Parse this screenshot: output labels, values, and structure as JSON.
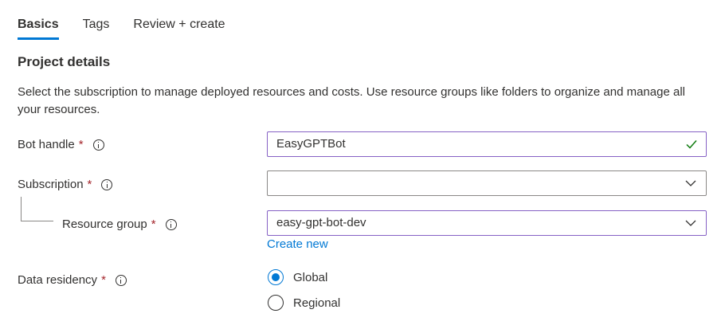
{
  "tabs": [
    {
      "label": "Basics",
      "active": true
    },
    {
      "label": "Tags",
      "active": false
    },
    {
      "label": "Review + create",
      "active": false
    }
  ],
  "section": {
    "title": "Project details",
    "description": "Select the subscription to manage deployed resources and costs. Use resource groups like folders to organize and manage all your resources."
  },
  "fields": {
    "bot_handle": {
      "label": "Bot handle",
      "required": "*",
      "value": "EasyGPTBot"
    },
    "subscription": {
      "label": "Subscription",
      "required": "*",
      "value": ""
    },
    "resource_group": {
      "label": "Resource group",
      "required": "*",
      "value": "easy-gpt-bot-dev",
      "create_new": "Create new"
    },
    "data_residency": {
      "label": "Data residency",
      "required": "*",
      "options": [
        {
          "label": "Global",
          "checked": true
        },
        {
          "label": "Regional",
          "checked": false
        }
      ]
    }
  },
  "colors": {
    "accent": "#0078d4",
    "focus_border": "#8661c5",
    "required": "#a4262c",
    "valid_check": "#107c10"
  },
  "icons": {
    "info": "info-icon",
    "chevron": "chevron-down-icon",
    "check": "checkmark-icon"
  }
}
